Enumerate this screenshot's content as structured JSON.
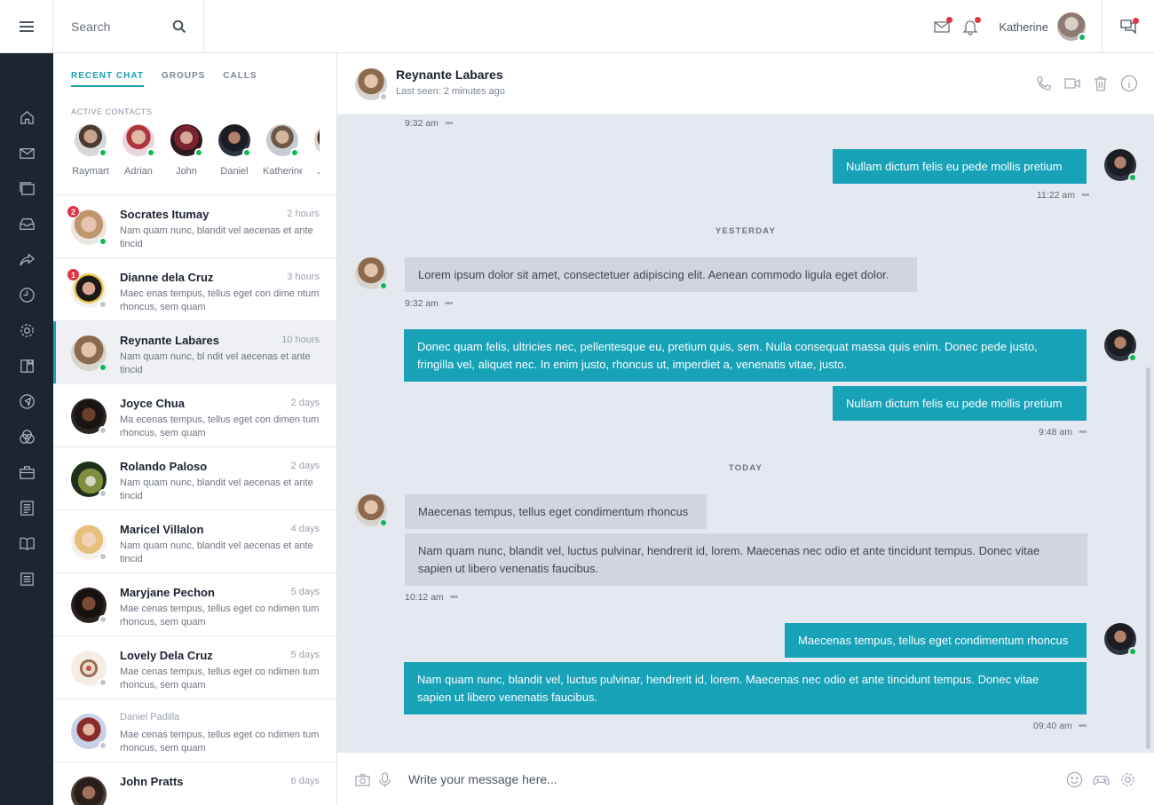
{
  "search": {
    "placeholder": "Search"
  },
  "user": {
    "name": "Katherine"
  },
  "colors": {
    "accent": "#17a2b8",
    "rail": "#1c2534",
    "online": "#10b759",
    "badge": "#dc3545"
  },
  "rail": {
    "icons": [
      "home-icon",
      "mail-icon",
      "files-icon",
      "inbox-icon",
      "share-icon",
      "clock-icon",
      "settings-icon",
      "book-icon",
      "navigation-icon",
      "circles-icon",
      "briefcase-icon",
      "document-icon",
      "open-book-icon",
      "list-icon"
    ]
  },
  "tabs": [
    "RECENT CHAT",
    "GROUPS",
    "CALLS"
  ],
  "active_contacts": {
    "label": "ACTIVE CONTACTS",
    "people": [
      "Raymart",
      "Adrian",
      "John",
      "Daniel",
      "Katherine",
      "Junris"
    ]
  },
  "conversations": [
    {
      "name": "Socrates Itumay",
      "time": "2 hours",
      "preview": "Nam quam nunc, blandit vel aecenas et ante tincid",
      "badge": "2"
    },
    {
      "name": "Dianne dela Cruz",
      "time": "3 hours",
      "preview": "Maec enas tempus, tellus eget con dime ntum rhoncus, sem quam",
      "badge": "1"
    },
    {
      "name": "Reynante Labares",
      "time": "10 hours",
      "preview": "Nam quam nunc, bl ndit vel aecenas et ante tincid"
    },
    {
      "name": "Joyce Chua",
      "time": "2 days",
      "preview": "Ma ecenas tempus, tellus eget con dimen tum rhoncus, sem quam"
    },
    {
      "name": "Rolando Paloso",
      "time": "2 days",
      "preview": "Nam quam nunc, blandit vel aecenas et ante tincid"
    },
    {
      "name": "Maricel Villalon",
      "time": "4 days",
      "preview": "Nam quam nunc, blandit vel aecenas et ante tincid"
    },
    {
      "name": "Maryjane Pechon",
      "time": "5 days",
      "preview": "Mae cenas tempus, tellus eget co ndimen tum rhoncus, sem quam"
    },
    {
      "name": "Lovely Dela Cruz",
      "time": "5 days",
      "preview": "Mae cenas tempus, tellus eget co ndimen tum rhoncus, sem quam"
    },
    {
      "name": "Daniel Padilla",
      "time": "",
      "preview": "Mae cenas tempus, tellus eget co ndimen tum rhoncus, sem quam"
    },
    {
      "name": "John Pratts",
      "time": "6 days",
      "preview": ""
    }
  ],
  "chat": {
    "name": "Reynante Labares",
    "status": "Last seen: 2 minutes ago",
    "messages": {
      "t0": "9:32 am",
      "m1": "Nullam dictum felis eu pede mollis pretium",
      "t1": "11:22 am",
      "yesterday": "YESTERDAY",
      "m2": "Lorem ipsum dolor sit amet, consectetuer adipiscing elit. Aenean commodo ligula eget dolor.",
      "t2": "9:32 am",
      "m3": "Donec quam felis, ultricies nec, pellentesque eu, pretium quis, sem. Nulla consequat massa quis enim. Donec pede justo, fringilla vel, aliquet nec. In enim justo, rhoncus ut, imperdiet a, venenatis vitae, justo.",
      "m4": "Nullam dictum felis eu pede mollis pretium",
      "t3": "9:48 am",
      "today": "TODAY",
      "m5": "Maecenas tempus, tellus eget condimentum rhoncus",
      "m6": "Nam quam nunc, blandit vel, luctus pulvinar, hendrerit id, lorem. Maecenas nec odio et ante tincidunt tempus. Donec vitae sapien ut libero venenatis faucibus.",
      "t4": "10:12 am",
      "m7": "Maecenas tempus, tellus eget condimentum rhoncus",
      "m8": "Nam quam nunc, blandit vel, luctus pulvinar, hendrerit id, lorem. Maecenas nec odio et ante tincidunt tempus. Donec vitae sapien ut libero venenatis faucibus.",
      "t5": "09:40 am",
      "dots": "•••"
    }
  },
  "composer": {
    "placeholder": "Write your message here..."
  }
}
